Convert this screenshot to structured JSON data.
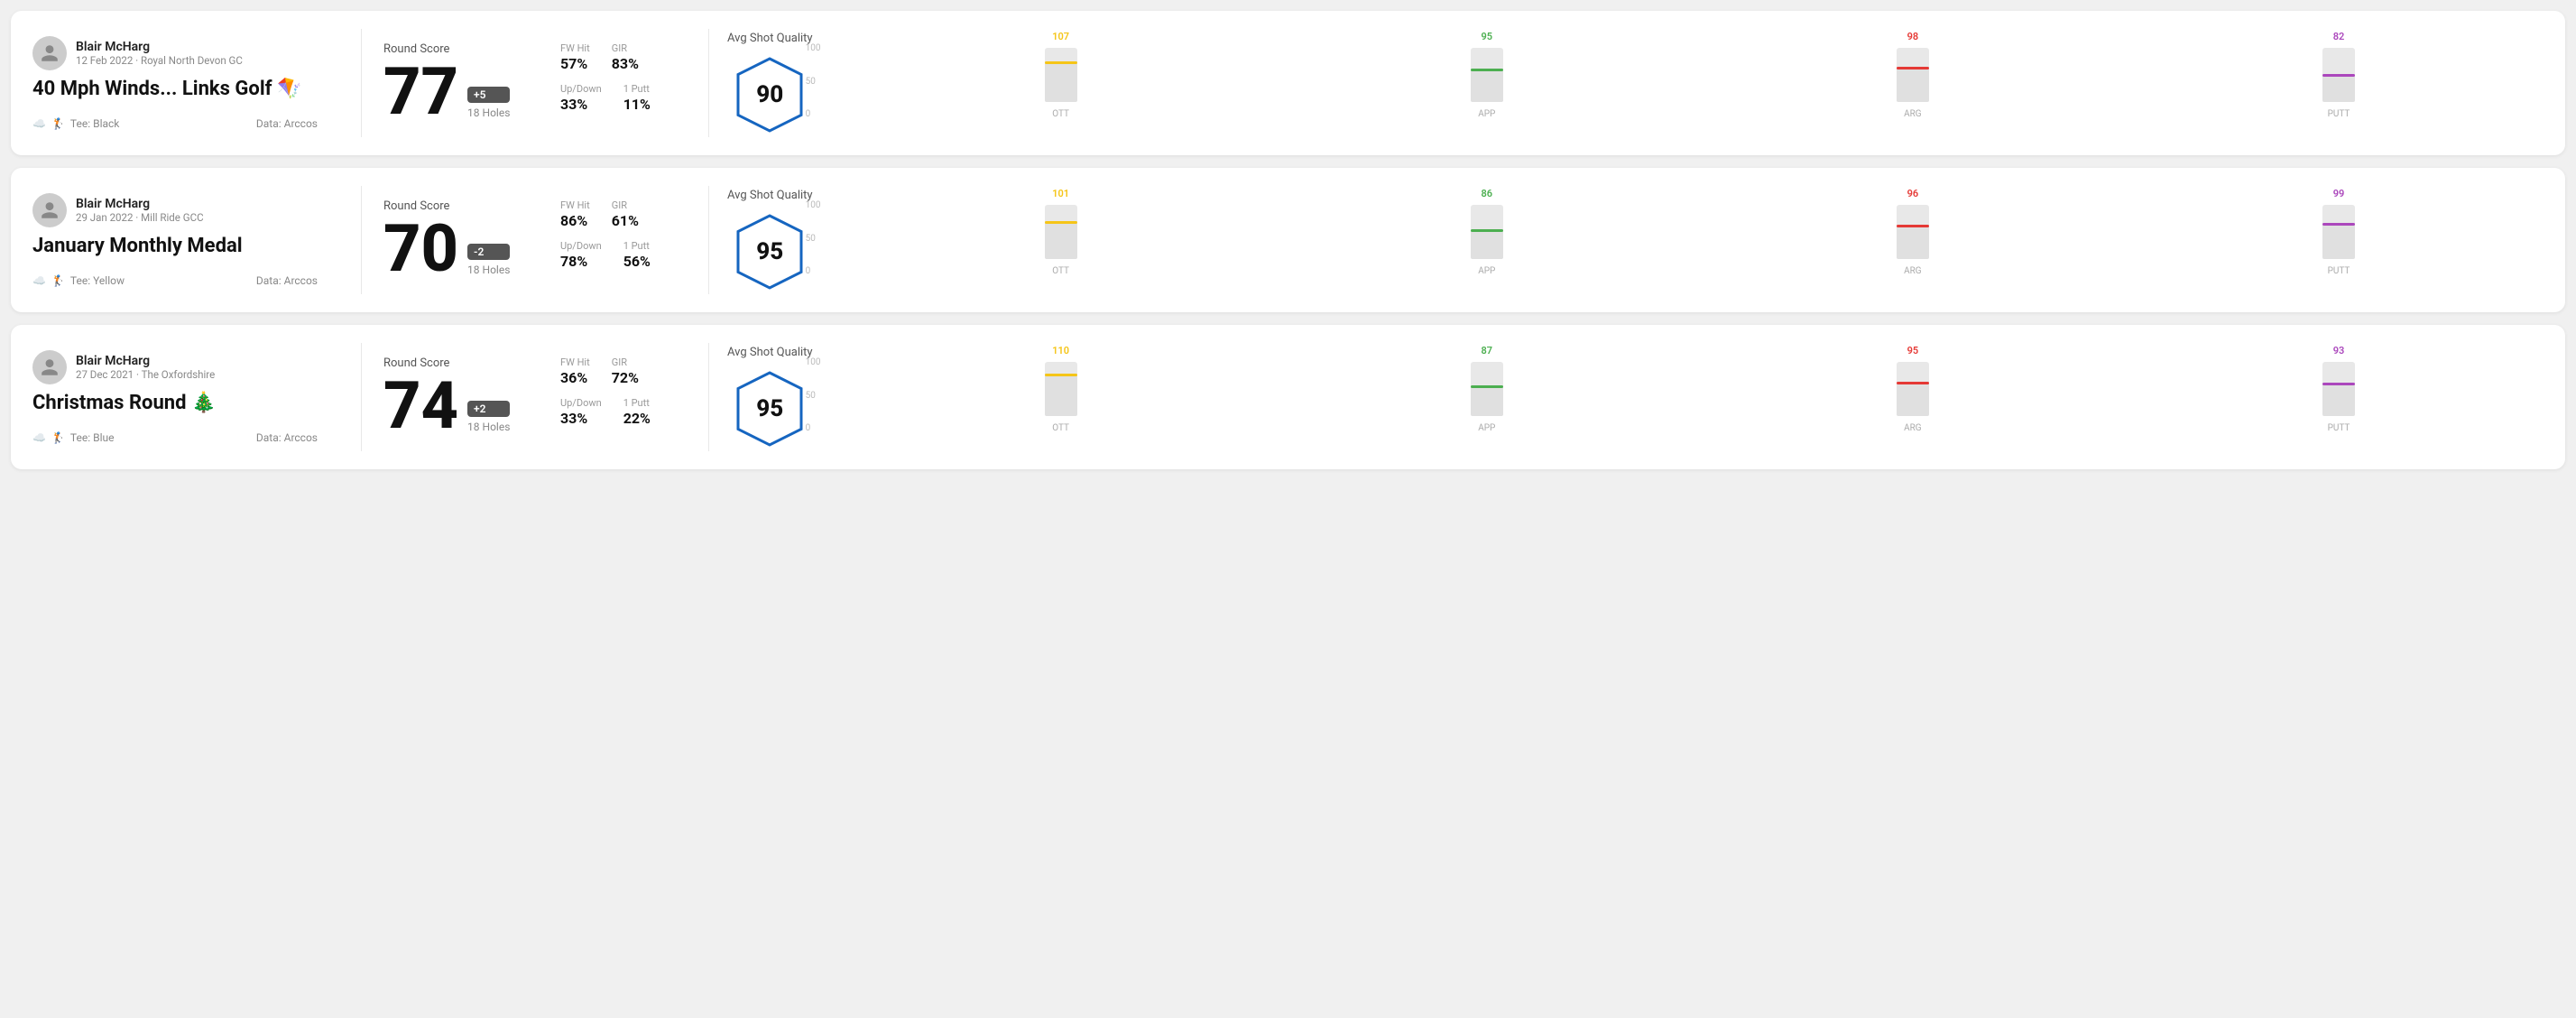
{
  "rounds": [
    {
      "id": "round1",
      "player_name": "Blair McHarg",
      "player_meta": "12 Feb 2022 · Royal North Devon GC",
      "title": "40 Mph Winds... Links Golf 🪁",
      "tee": "Tee: Black",
      "data_source": "Data: Arccos",
      "score": "77",
      "score_modifier": "+5",
      "score_modifier_type": "pos",
      "holes": "18 Holes",
      "fw_hit": "57%",
      "gir": "83%",
      "up_down": "33%",
      "one_putt": "11%",
      "avg_quality": "90",
      "chart": {
        "bars": [
          {
            "label": "OTT",
            "value": 107,
            "max": 120,
            "height_pct": 75,
            "color": "#f5c518"
          },
          {
            "label": "APP",
            "value": 95,
            "max": 120,
            "height_pct": 62,
            "color": "#4caf50"
          },
          {
            "label": "ARG",
            "value": 98,
            "max": 120,
            "height_pct": 65,
            "color": "#e53935"
          },
          {
            "label": "PUTT",
            "value": 82,
            "max": 120,
            "height_pct": 52,
            "color": "#ab47bc"
          }
        ]
      }
    },
    {
      "id": "round2",
      "player_name": "Blair McHarg",
      "player_meta": "29 Jan 2022 · Mill Ride GCC",
      "title": "January Monthly Medal",
      "tee": "Tee: Yellow",
      "data_source": "Data: Arccos",
      "score": "70",
      "score_modifier": "-2",
      "score_modifier_type": "neg",
      "holes": "18 Holes",
      "fw_hit": "86%",
      "gir": "61%",
      "up_down": "78%",
      "one_putt": "56%",
      "avg_quality": "95",
      "chart": {
        "bars": [
          {
            "label": "OTT",
            "value": 101,
            "max": 120,
            "height_pct": 70,
            "color": "#f5c518"
          },
          {
            "label": "APP",
            "value": 86,
            "max": 120,
            "height_pct": 55,
            "color": "#4caf50"
          },
          {
            "label": "ARG",
            "value": 96,
            "max": 120,
            "height_pct": 64,
            "color": "#e53935"
          },
          {
            "label": "PUTT",
            "value": 99,
            "max": 120,
            "height_pct": 66,
            "color": "#ab47bc"
          }
        ]
      }
    },
    {
      "id": "round3",
      "player_name": "Blair McHarg",
      "player_meta": "27 Dec 2021 · The Oxfordshire",
      "title": "Christmas Round 🎄",
      "tee": "Tee: Blue",
      "data_source": "Data: Arccos",
      "score": "74",
      "score_modifier": "+2",
      "score_modifier_type": "pos",
      "holes": "18 Holes",
      "fw_hit": "36%",
      "gir": "72%",
      "up_down": "33%",
      "one_putt": "22%",
      "avg_quality": "95",
      "chart": {
        "bars": [
          {
            "label": "OTT",
            "value": 110,
            "max": 120,
            "height_pct": 78,
            "color": "#f5c518"
          },
          {
            "label": "APP",
            "value": 87,
            "max": 120,
            "height_pct": 56,
            "color": "#4caf50"
          },
          {
            "label": "ARG",
            "value": 95,
            "max": 120,
            "height_pct": 64,
            "color": "#e53935"
          },
          {
            "label": "PUTT",
            "value": 93,
            "max": 120,
            "height_pct": 62,
            "color": "#ab47bc"
          }
        ]
      }
    }
  ],
  "y_axis_labels": [
    "100",
    "50",
    "0"
  ]
}
